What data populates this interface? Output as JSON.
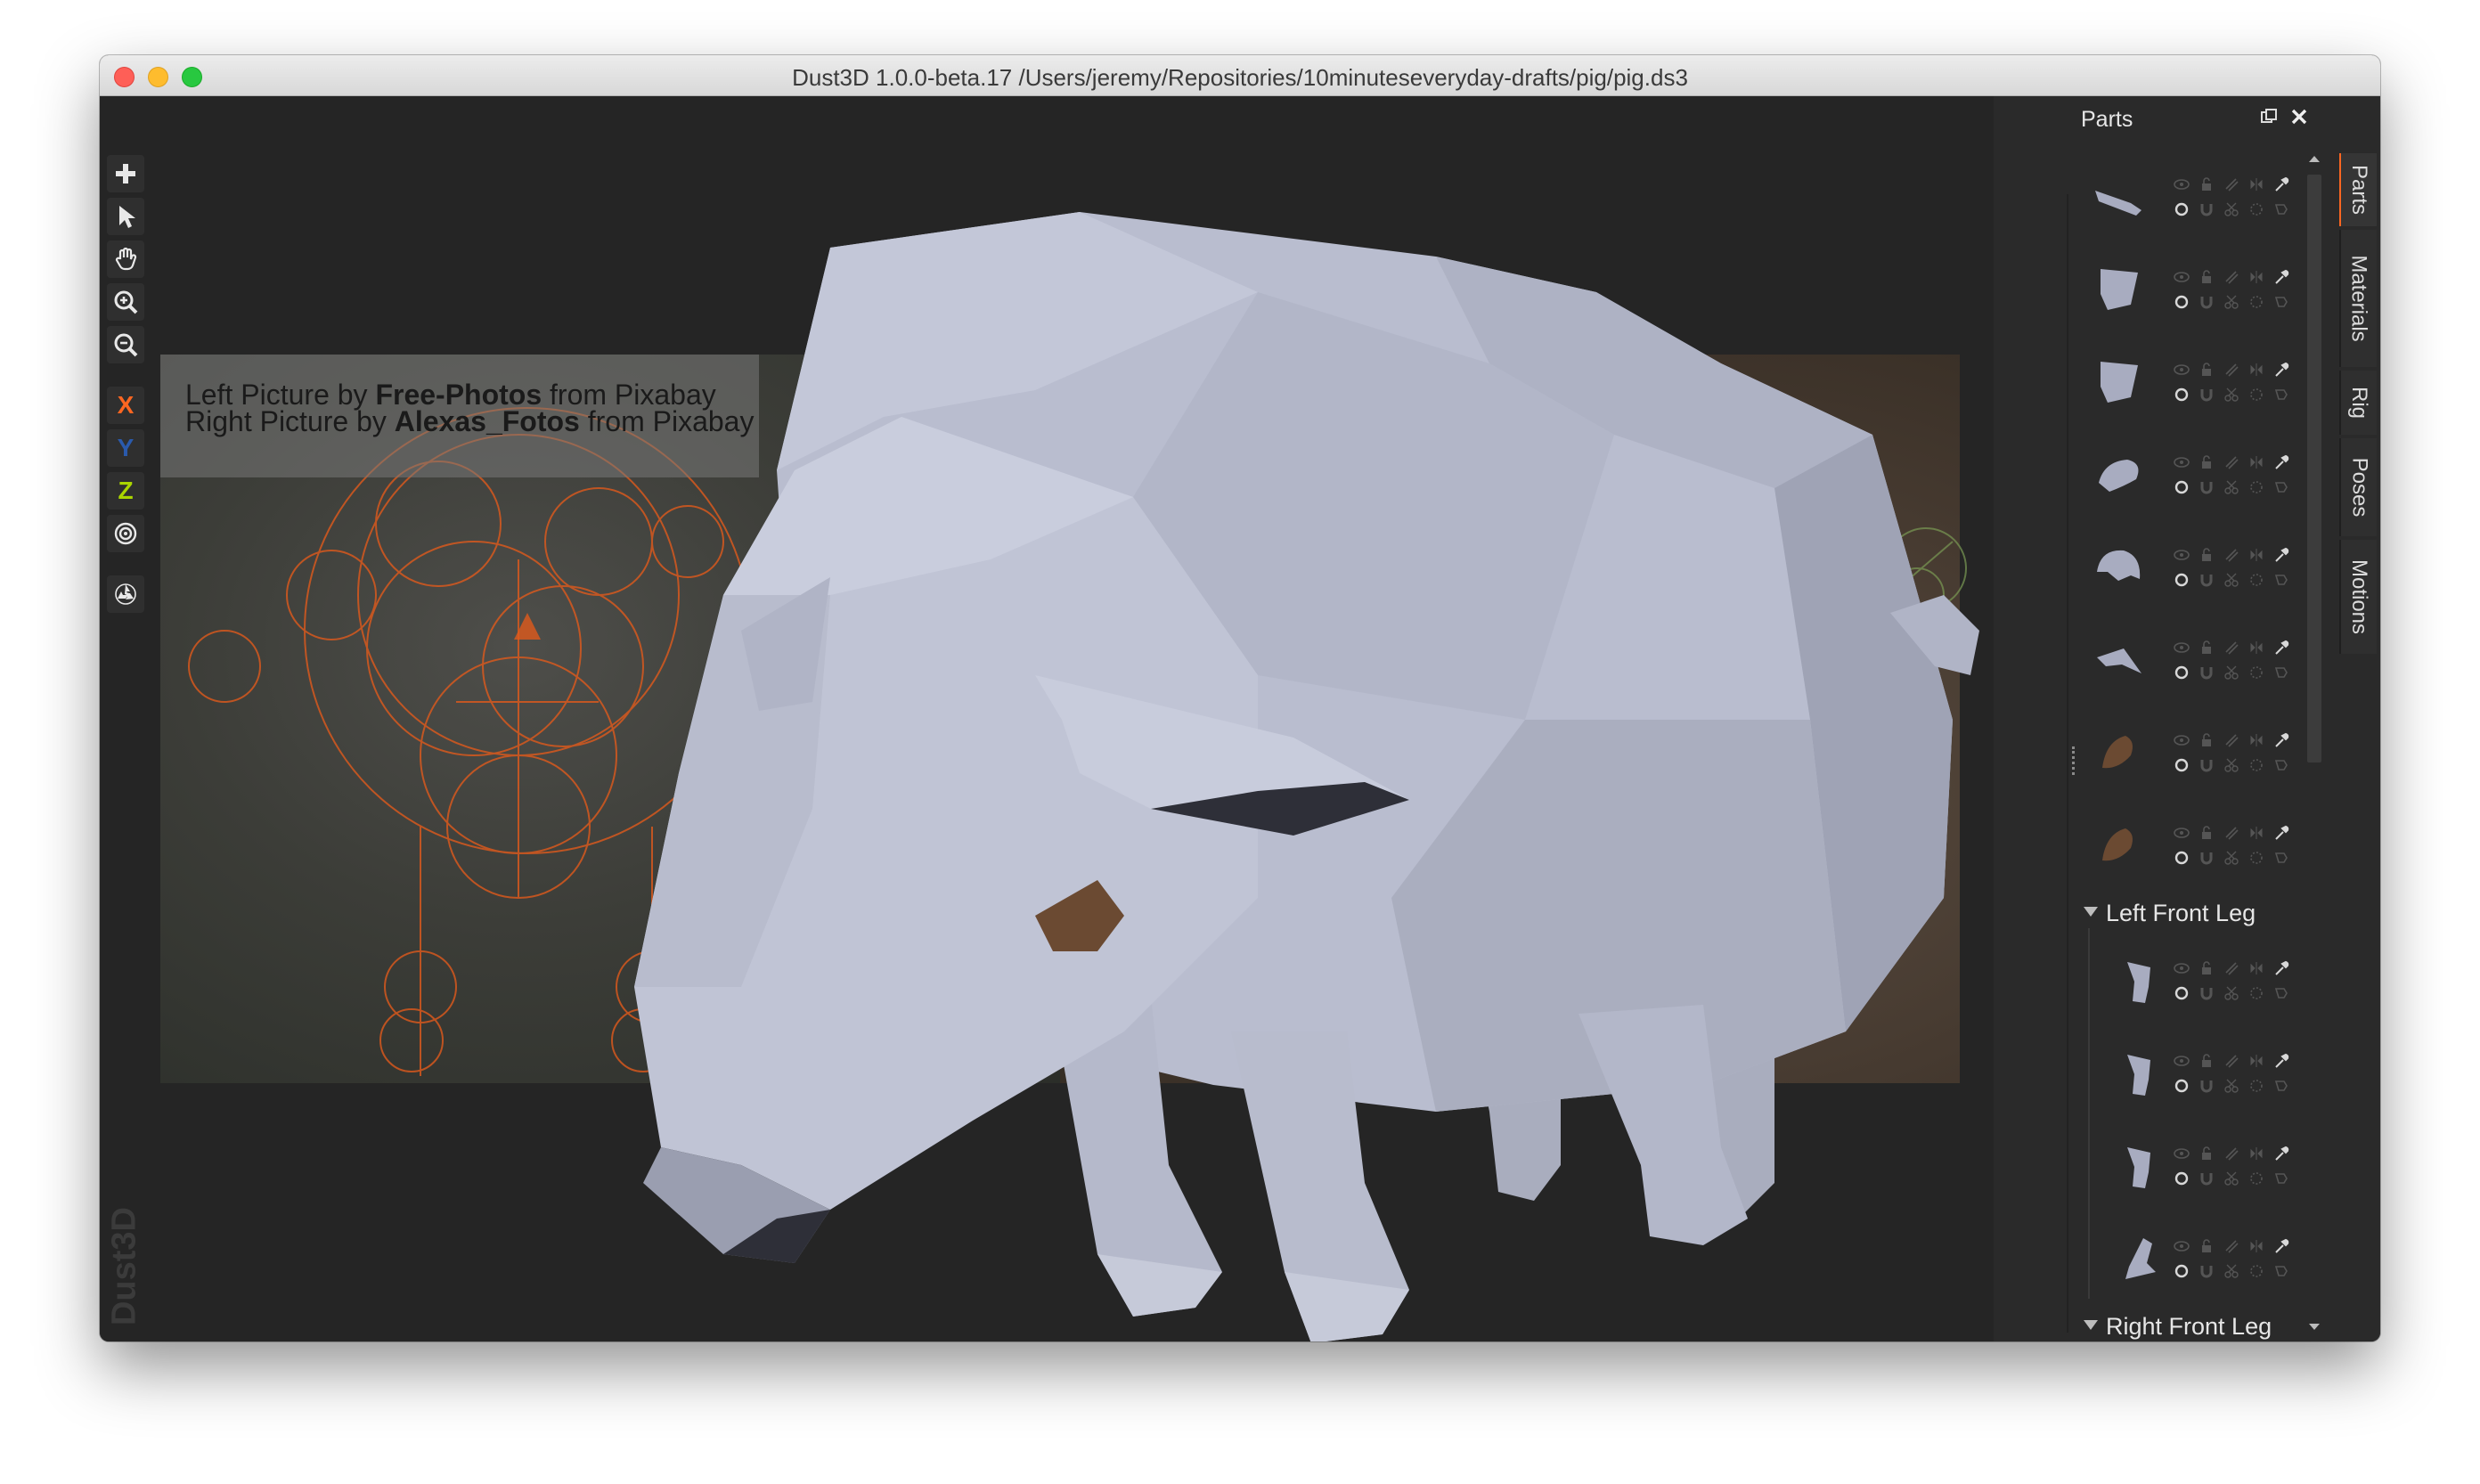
{
  "window": {
    "title": "Dust3D 1.0.0-beta.17 /Users/jeremy/Repositories/10minuteseveryday-drafts/pig/pig.ds3"
  },
  "viewport": {
    "credit_line1": {
      "prefix": "Left Picture by ",
      "author": "Free-Photos",
      "suffix": " from Pixabay"
    },
    "credit_line2": {
      "prefix": "Right Picture by ",
      "author": "Alexas_Fotos",
      "suffix": " from Pixabay"
    },
    "watermark": "Dust3D"
  },
  "toolbar": {
    "tools": [
      {
        "name": "add-tool",
        "icon": "plus-icon"
      },
      {
        "name": "select-tool",
        "icon": "pointer-icon"
      },
      {
        "name": "pan-tool",
        "icon": "hand-icon"
      },
      {
        "name": "zoom-in-tool",
        "icon": "zoom-in-icon"
      },
      {
        "name": "zoom-out-tool",
        "icon": "zoom-out-icon"
      }
    ],
    "axes": [
      {
        "label": "X",
        "color": "#fc6621"
      },
      {
        "label": "Y",
        "color": "#2a5aac"
      },
      {
        "label": "Z",
        "color": "#aad500"
      }
    ],
    "extra_tools": [
      {
        "name": "radius-tool",
        "icon": "target-icon"
      },
      {
        "name": "regenerate-tool",
        "icon": "recycle-icon"
      }
    ]
  },
  "panel": {
    "title": "Parts",
    "tabs": [
      "Parts",
      "Materials",
      "Rig",
      "Poses",
      "Motions"
    ],
    "active_tab": "Parts",
    "accent_color": "#fc6621",
    "parts": [
      {
        "thumb": "tail-part-icon",
        "color": "#a8acc0"
      },
      {
        "thumb": "ear-part-icon",
        "color": "#a8acc0"
      },
      {
        "thumb": "ear-part-icon",
        "color": "#a8acc0"
      },
      {
        "thumb": "snout-part-icon",
        "color": "#a8acc0"
      },
      {
        "thumb": "head-part-icon",
        "color": "#a8acc0"
      },
      {
        "thumb": "wing-part-icon",
        "color": "#a8acc0"
      },
      {
        "thumb": "eye-part-icon",
        "color": "#6b4a32"
      },
      {
        "thumb": "eye-part-icon",
        "color": "#6b4a32"
      }
    ],
    "groups": [
      {
        "label": "Left Front Leg",
        "expanded": true,
        "parts": [
          {
            "thumb": "leg-part-icon",
            "color": "#a8acc0"
          },
          {
            "thumb": "leg-part-icon",
            "color": "#a8acc0"
          },
          {
            "thumb": "leg-part-icon",
            "color": "#a8acc0"
          },
          {
            "thumb": "foot-part-icon",
            "color": "#a8acc0"
          }
        ]
      },
      {
        "label": "Right Front Leg",
        "expanded": true,
        "parts": []
      }
    ]
  },
  "colors": {
    "window_bg": "#252525",
    "panel_bg": "#2a2a2a",
    "model": "#b8bccd",
    "eye": "#6b4a32",
    "overlay": "#e05a1c"
  }
}
